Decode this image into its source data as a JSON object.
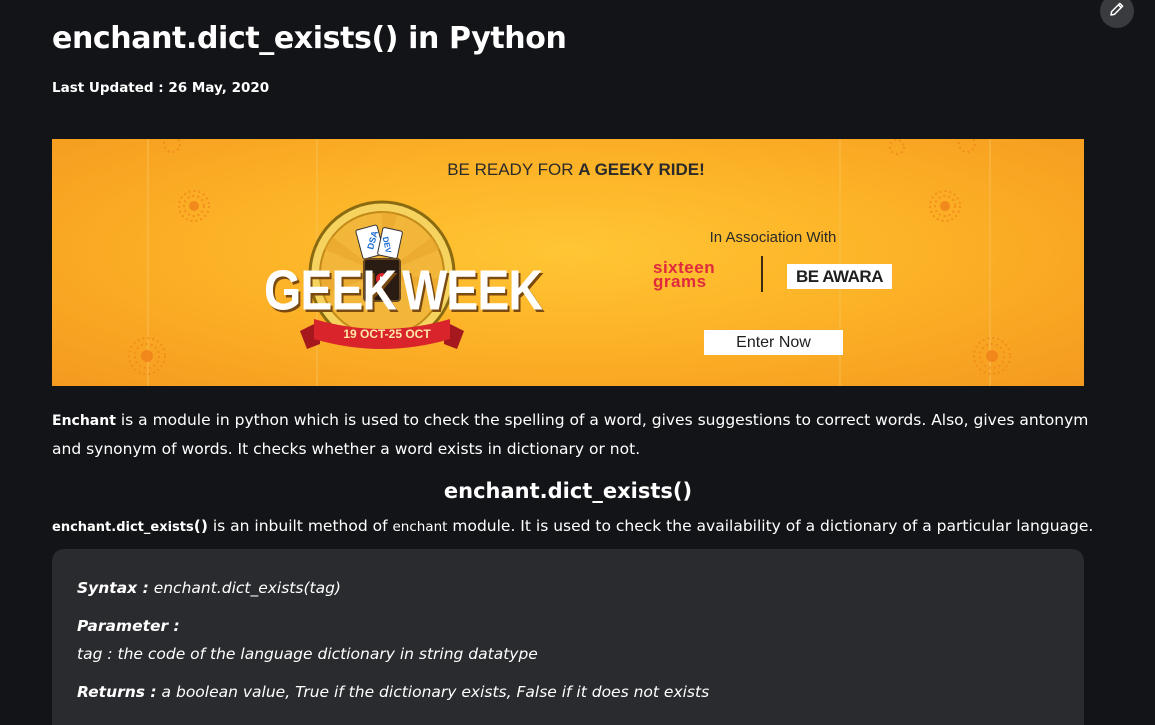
{
  "article": {
    "title": "enchant.dict_exists() in Python",
    "last_updated": "Last Updated : 26 May, 2020"
  },
  "banner": {
    "tagline_prefix": "BE READY FOR ",
    "tagline_bold": "A GEEKY RIDE!",
    "logo_word_left": "GEEK",
    "logo_word_right": "WEEK",
    "dates": "19 OCT-25 OCT",
    "ticket_labels": [
      "DSA",
      "DEV"
    ],
    "association_text": "In Association With",
    "partner_one_line1": "sixteen",
    "partner_one_line2": "grams",
    "partner_two": "BE AWARA",
    "cta_label": "Enter Now",
    "colors": {
      "background": "#fdb327",
      "cta": "#ffffff",
      "ribbon": "#d8242a"
    }
  },
  "intro": {
    "term": "Enchant",
    "text": " is a module in python which is used to check the spelling of a word, gives suggestions to correct words. Also, gives antonym and synonym of words. It checks whether a word exists in dictionary or not."
  },
  "section": {
    "heading": "enchant.dict_exists()",
    "method_name": "enchant.dict_exists",
    "method_suffix": "()",
    "text_mid": " is an inbuilt method of ",
    "module_name": "enchant",
    "text_end": " module. It is used to check the availability of a dictionary of a particular language."
  },
  "syntax_block": {
    "syntax_label": "Syntax :",
    "syntax_value": " enchant.dict_exists(tag)",
    "parameter_label": "Parameter :",
    "parameter_value": "tag : the code of the language dictionary in string datatype",
    "returns_label": "Returns :",
    "returns_value": " a boolean value, True if the dictionary exists, False if it does not exists"
  },
  "icons": {
    "edit": "pencil-icon"
  },
  "colors": {
    "page_background": "#131417",
    "code_background": "#2a2b2e",
    "text": "#ffffff"
  }
}
